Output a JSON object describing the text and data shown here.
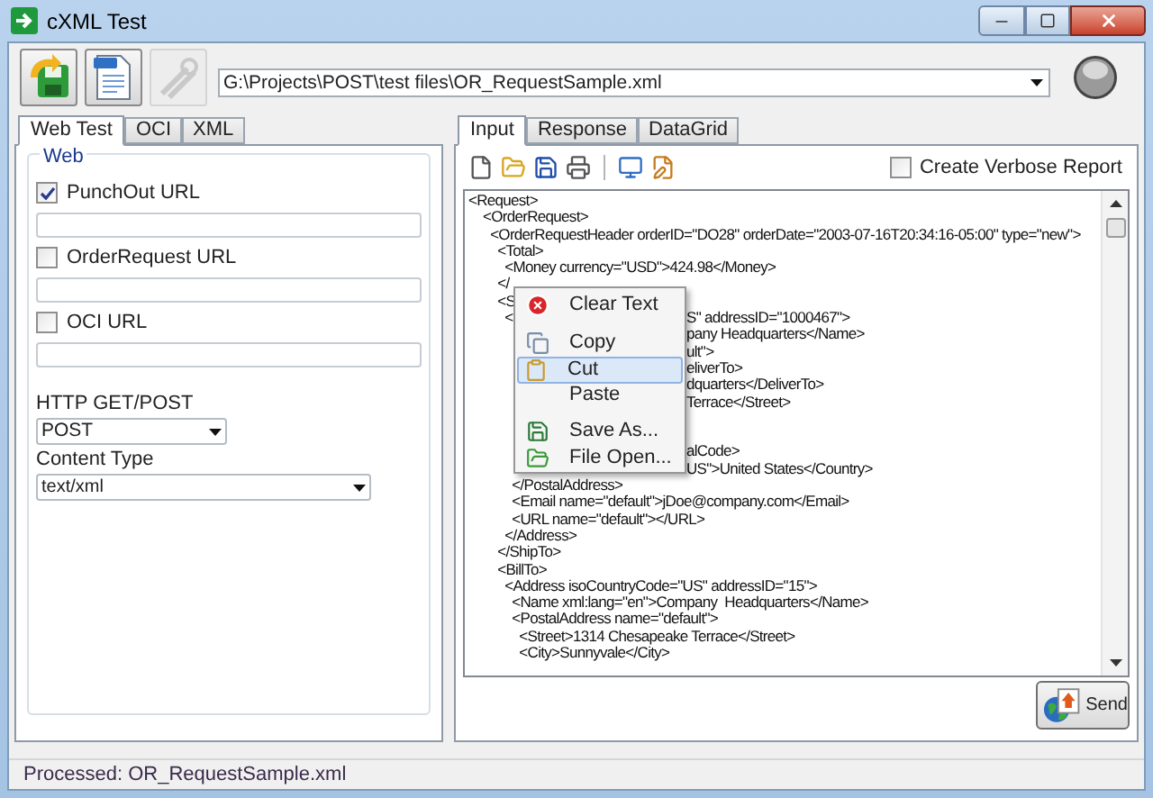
{
  "window": {
    "title": "cXML Test"
  },
  "toolbar": {
    "buttons": [
      {
        "kind": "load",
        "disabled": false
      },
      {
        "kind": "xml",
        "disabled": false
      },
      {
        "kind": "tools",
        "disabled": true
      }
    ],
    "path": {
      "value": "G:\\Projects\\POST\\test files\\OR_RequestSample.xml"
    }
  },
  "left_tabs": [
    {
      "label": "Web Test",
      "selected": true
    },
    {
      "label": "OCI",
      "selected": false
    },
    {
      "label": "XML",
      "selected": false
    }
  ],
  "web_group": {
    "title": "Web",
    "urls": [
      {
        "label": "PunchOut URL",
        "checked": true
      },
      {
        "label": "OrderRequest URL",
        "checked": false
      },
      {
        "label": "OCI URL",
        "checked": false
      }
    ],
    "method": {
      "label": "HTTP GET/POST",
      "value": "POST"
    },
    "content_type": {
      "label": "Content Type",
      "value": "text/xml"
    }
  },
  "right_tabs": [
    {
      "label": "Input",
      "selected": true
    },
    {
      "label": "Response",
      "selected": false
    },
    {
      "label": "DataGrid",
      "selected": false
    }
  ],
  "editor_toolbar": {
    "buttons": [
      {
        "kind": "new"
      },
      {
        "kind": "open"
      },
      {
        "kind": "save"
      },
      {
        "kind": "print"
      },
      {
        "kind": "separator"
      },
      {
        "kind": "view"
      },
      {
        "kind": "edit"
      }
    ],
    "verbose_report": {
      "label": "Create Verbose Report",
      "checked": false
    }
  },
  "editor": {
    "lines": [
      {
        "kind": "line",
        "text": "<Request>"
      },
      {
        "kind": "line",
        "text": "    <OrderRequest>"
      },
      {
        "kind": "line",
        "text": "      <OrderRequestHeader orderID=\"DO28\" orderDate=\"2003-07-16T20:34:16-05:00\" type=\"new\">"
      },
      {
        "kind": "line",
        "text": "        <Total>"
      },
      {
        "kind": "line",
        "text": "          <Money currency=\"USD\">424.98</Money>"
      },
      {
        "kind": "covered",
        "left": "        </"
      },
      {
        "kind": "covered",
        "left": "        <S"
      },
      {
        "kind": "covered",
        "left": "          <",
        "right": "S\" addressID=\"1000467\">"
      },
      {
        "kind": "covered",
        "right": "pany Headquarters</Name>"
      },
      {
        "kind": "covered",
        "right": "ult\">"
      },
      {
        "kind": "covered",
        "right": "eliverTo>"
      },
      {
        "kind": "covered",
        "right": "dquarters</DeliverTo>"
      },
      {
        "kind": "covered",
        "right": "Terrace</Street>"
      },
      {
        "kind": "covered"
      },
      {
        "kind": "covered"
      },
      {
        "kind": "covered",
        "right": "alCode>"
      },
      {
        "kind": "covered",
        "right": "US\">United States</Country>"
      },
      {
        "kind": "line",
        "text": "            </PostalAddress>"
      },
      {
        "kind": "line",
        "text": "            <Email name=\"default\">jDoe@company.com</Email>"
      },
      {
        "kind": "line",
        "text": "            <URL name=\"default\"></URL>"
      },
      {
        "kind": "line",
        "text": "          </Address>"
      },
      {
        "kind": "line",
        "text": "        </ShipTo>"
      },
      {
        "kind": "line",
        "text": "        <BillTo>"
      },
      {
        "kind": "line",
        "text": "          <Address isoCountryCode=\"US\" addressID=\"15\">"
      },
      {
        "kind": "line",
        "text": "            <Name xml:lang=\"en\">Company  Headquarters</Name>"
      },
      {
        "kind": "line",
        "text": "            <PostalAddress name=\"default\">"
      },
      {
        "kind": "line",
        "text": "              <Street>1314 Chesapeake Terrace</Street>"
      },
      {
        "kind": "line",
        "text": "              <City>Sunnyvale</City>"
      }
    ]
  },
  "context_menu": {
    "items": [
      {
        "kind": "clear",
        "label": "Clear Text",
        "selected": false
      },
      {
        "kind": "separator"
      },
      {
        "kind": "copy",
        "label": "Copy",
        "selected": false
      },
      {
        "kind": "cut",
        "label": "Cut",
        "selected": true
      },
      {
        "kind": "plain",
        "label": "Paste",
        "selected": false
      },
      {
        "kind": "separator"
      },
      {
        "kind": "saveas",
        "label": "Save As...",
        "selected": false
      },
      {
        "kind": "open",
        "label": "File Open...",
        "selected": false
      }
    ]
  },
  "send_button": {
    "label": "Send"
  },
  "status_bar": {
    "text": "Processed: OR_RequestSample.xml"
  }
}
